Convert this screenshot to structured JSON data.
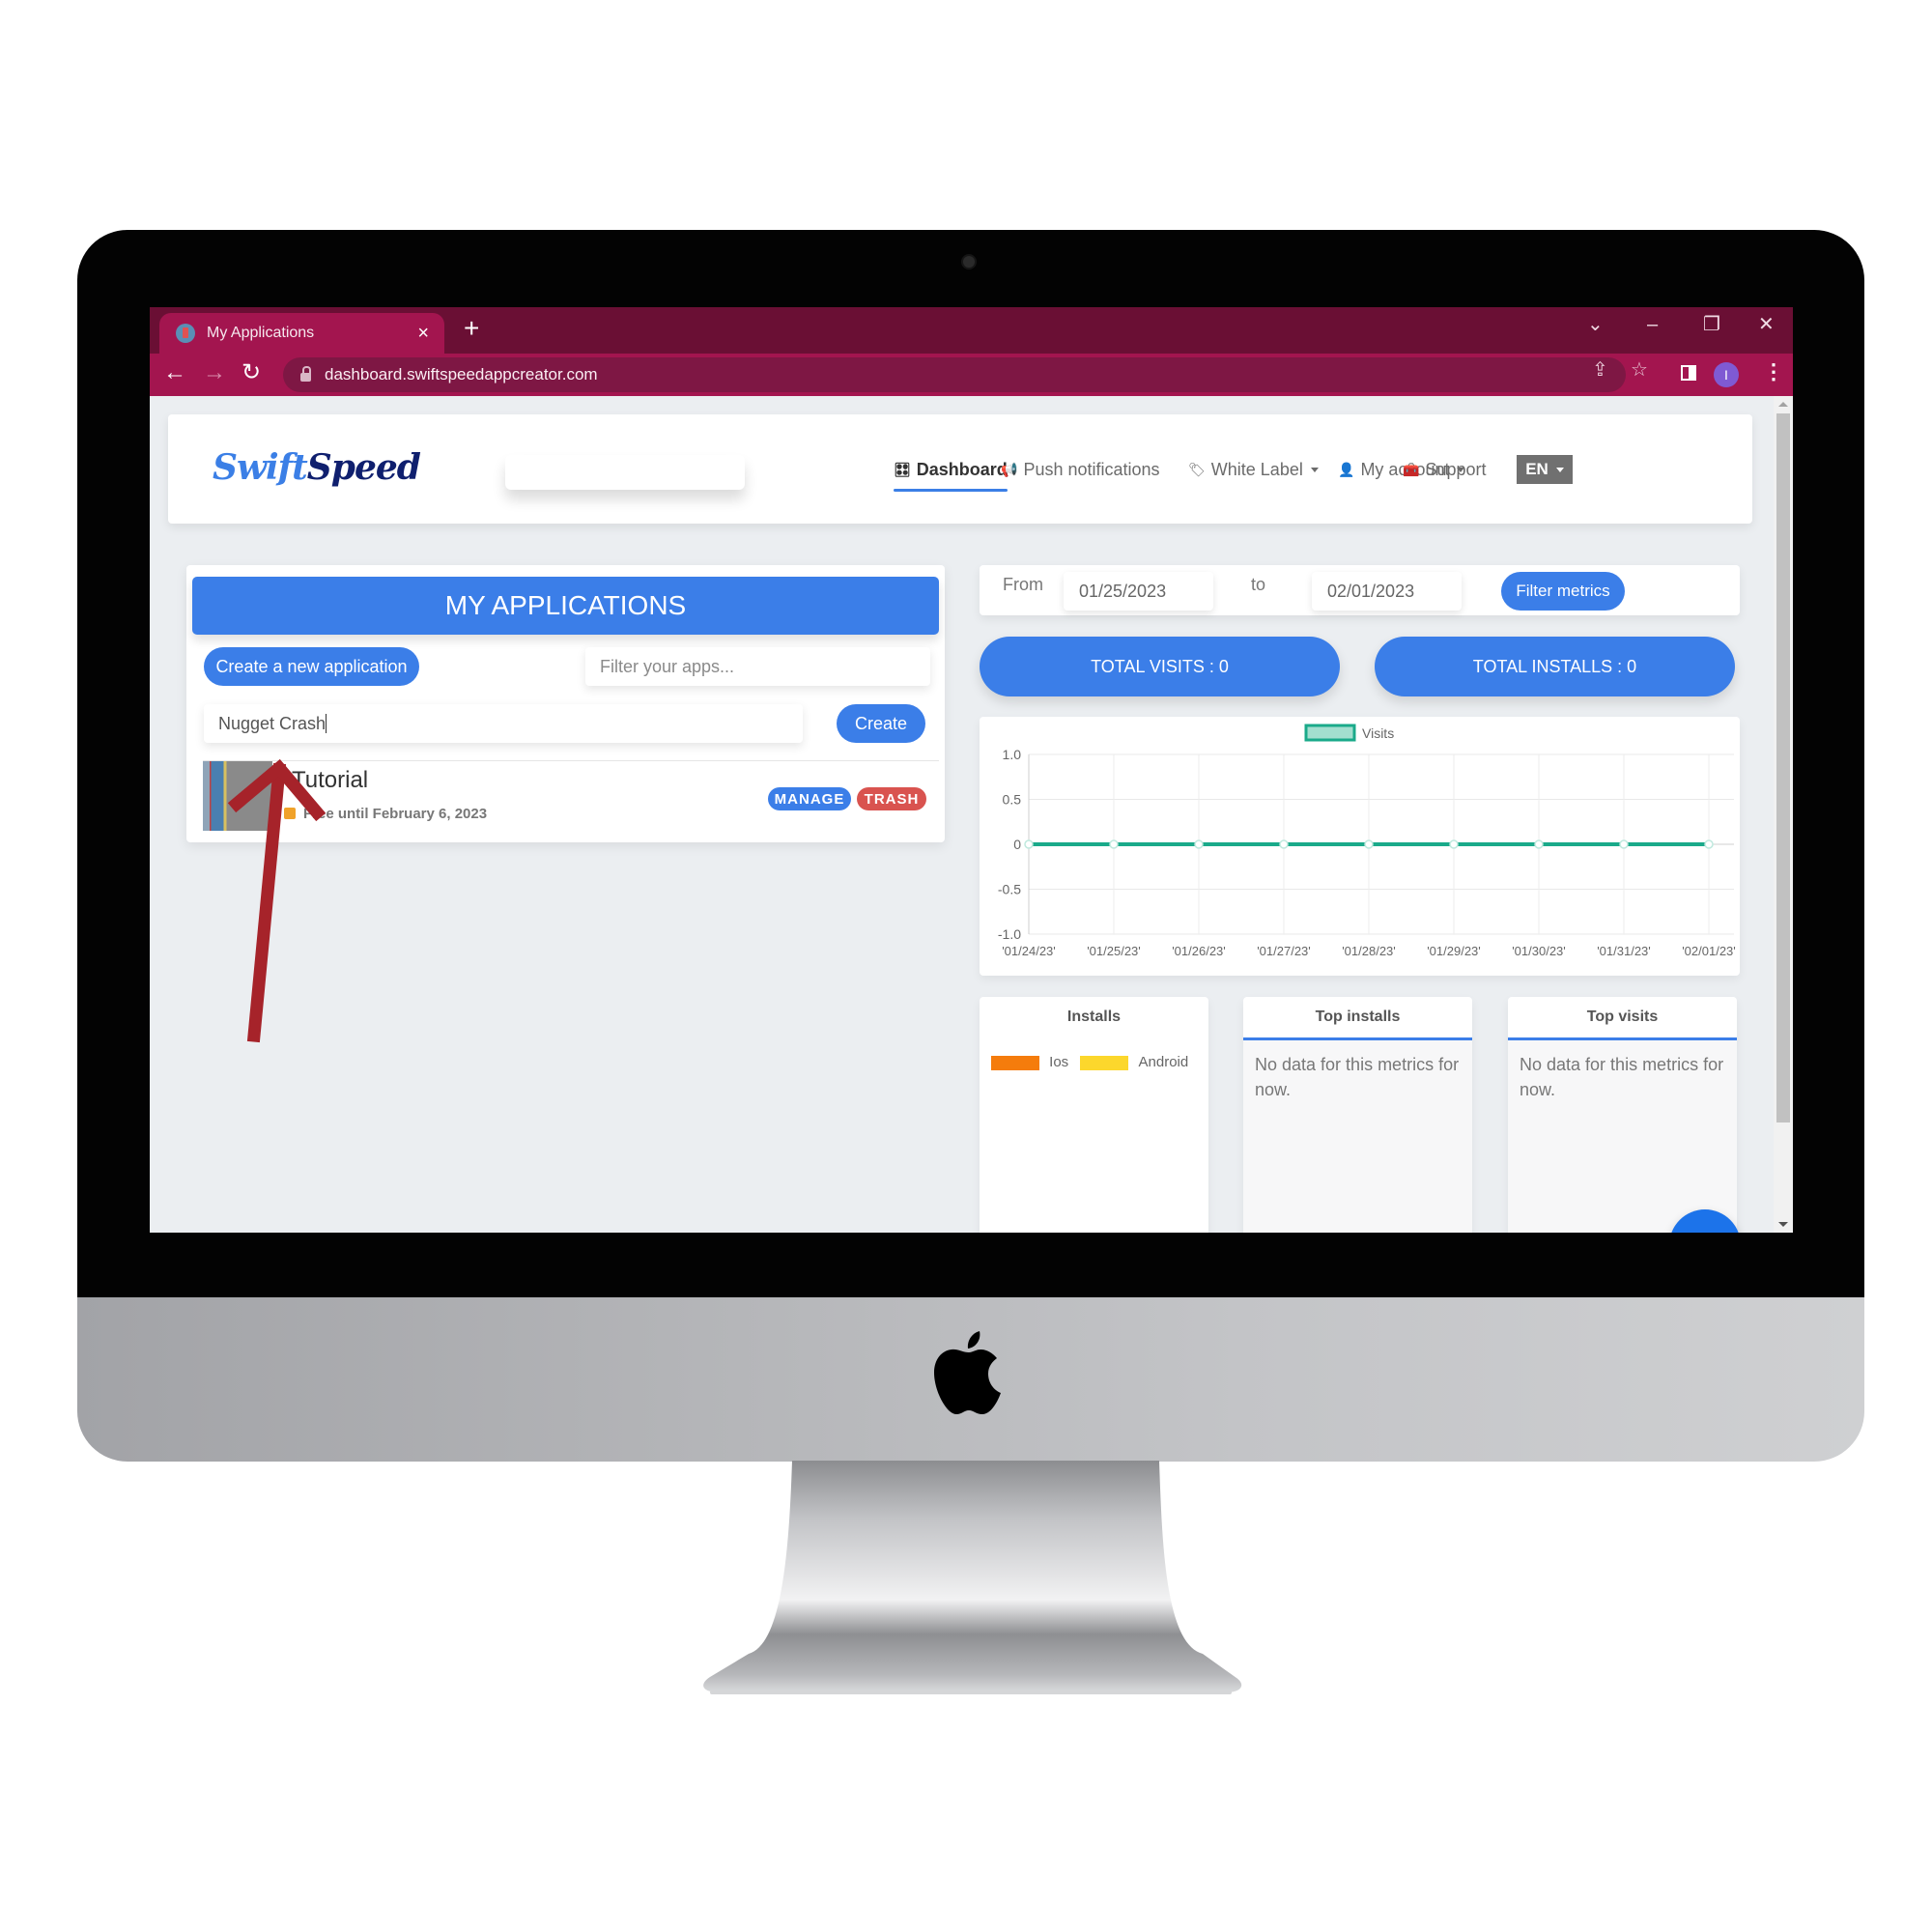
{
  "browser": {
    "tab_title": "My Applications",
    "tab_close": "×",
    "new_tab": "+",
    "url": "dashboard.swiftspeedappcreator.com",
    "profile_initial": "I",
    "window_controls": {
      "tab_search": "⌄",
      "minimize": "–",
      "restore": "❐",
      "close": "✕"
    },
    "nav": {
      "back": "←",
      "forward": "→",
      "reload": "↻"
    },
    "omnibox_icons": {
      "share": "⇪",
      "bookmark": "☆"
    },
    "menu": "⋮"
  },
  "header": {
    "logo_part1": "Swift",
    "logo_part2": "Speed",
    "nav": [
      {
        "label": "Dashboard",
        "icon": "🎛",
        "active": true
      },
      {
        "label": "Push notifications",
        "icon": "📢"
      },
      {
        "label": "White Label",
        "icon": "🏷",
        "dropdown": true
      },
      {
        "label": "My account",
        "icon": "👤",
        "dropdown": true
      },
      {
        "label": "Support",
        "icon": "🧰"
      }
    ],
    "language": "EN"
  },
  "apps": {
    "title": "MY APPLICATIONS",
    "create_new_label": "Create a new application",
    "filter_placeholder": "Filter your apps...",
    "new_app_name_value": "Nugget Crash",
    "create_button": "Create",
    "list": [
      {
        "name": "Tutorial",
        "status": "Free until February 6, 2023",
        "manage": "MANAGE",
        "trash": "TRASH"
      }
    ]
  },
  "metrics": {
    "from_label": "From",
    "from_date": "01/25/2023",
    "to_label": "to",
    "to_date": "02/01/2023",
    "filter_button": "Filter metrics",
    "total_visits": "TOTAL VISITS : 0",
    "total_installs": "TOTAL INSTALLS : 0",
    "installs_card": {
      "title": "Installs",
      "legend": [
        {
          "label": "Ios",
          "color": "#f57c0c"
        },
        {
          "label": "Android",
          "color": "#fcd72c"
        }
      ]
    },
    "top_installs": {
      "title": "Top installs",
      "empty": "No data for this metrics for now."
    },
    "top_visits": {
      "title": "Top visits",
      "empty": "No data for this metrics for now."
    }
  },
  "colors": {
    "brand_blue": "#3b7ee8",
    "trash_red": "#d9534f",
    "chrome_dark": "#6a0f34",
    "chrome_tab": "#a3154f",
    "series": "#1aaa8a",
    "annotation_arrow": "#a6232a"
  },
  "chart_data": {
    "type": "line",
    "title": "",
    "xlabel": "",
    "ylabel": "",
    "x": [
      "'01/24/23'",
      "'01/25/23'",
      "'01/26/23'",
      "'01/27/23'",
      "'01/28/23'",
      "'01/29/23'",
      "'01/30/23'",
      "'01/31/23'",
      "'02/01/23'"
    ],
    "series": [
      {
        "name": "Visits",
        "values": [
          0,
          0,
          0,
          0,
          0,
          0,
          0,
          0,
          0
        ],
        "color": "#1aaa8a"
      }
    ],
    "ylim": [
      -1.0,
      1.0
    ],
    "yticks": [
      "1.0",
      "0.5",
      "0",
      "-0.5",
      "-1.0"
    ],
    "ytick_values": [
      1.0,
      0.5,
      0,
      -0.5,
      -1.0
    ],
    "grid": true,
    "legend": "top-center"
  }
}
